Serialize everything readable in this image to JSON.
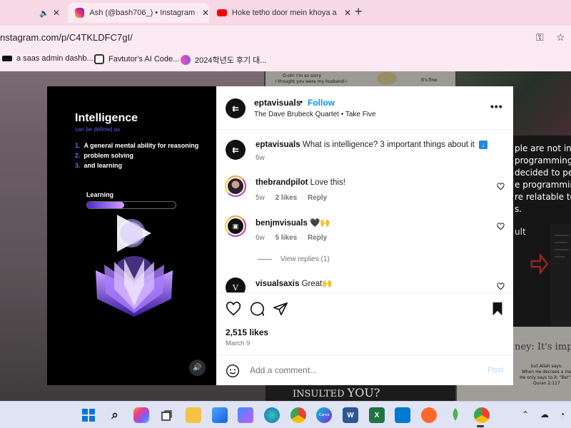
{
  "browser": {
    "tabs": [
      {
        "title": "Ash (@bash706_) • Instagram p",
        "icon": "instagram-icon"
      },
      {
        "title": "Hoke tetho door mein khoya a",
        "icon": "youtube-icon"
      }
    ],
    "tab_close": "✕",
    "new_tab": "+",
    "url": "nstagram.com/p/C4TKLDFC7gI/",
    "bookmarks": [
      {
        "label": "a saas admin dashb..."
      },
      {
        "label": "Favtutor's AI Code..."
      },
      {
        "label": "2024학년도 후기 대..."
      }
    ]
  },
  "backdrop": {
    "left_caption": "O-oh! I'm so sorry\nI thought you were my husband-!",
    "right_caption": "It's fine",
    "right_text": [
      "ple are not inte",
      "programming, so",
      "decided to pers",
      "e programming",
      "re relatable to",
      "s."
    ],
    "ult_label": "ult",
    "bottom_right": "ney: It's impo",
    "insulted": "INSULTED",
    "you": "YOU?",
    "allah_text": [
      "but Allah says:",
      "When He decrees a ma",
      "He only says to it: \"Be!\" -",
      "Quran 2:117"
    ]
  },
  "post": {
    "media": {
      "title": "Intelligence",
      "subtitle": "can be defined as",
      "list": [
        {
          "num": "1.",
          "text": "A general mental ability for reasoning"
        },
        {
          "num": "2.",
          "text": "problem solving"
        },
        {
          "num": "3.",
          "text": "and learning"
        }
      ],
      "learning_label": "Learning",
      "learning_progress": 0.42
    },
    "header": {
      "username": "eptavisuals",
      "separator": "•",
      "follow": "Follow",
      "audio": "The Dave Brubeck Quartet • Take Five",
      "more": "•••"
    },
    "caption": {
      "username": "eptavisuals",
      "text": "What is intelligence? 3 important things about it",
      "time": "6w"
    },
    "comments": [
      {
        "username": "thebrandpilot",
        "text": "Love this!",
        "time": "5w",
        "likes": "2 likes",
        "reply": "Reply"
      },
      {
        "username": "benjmvisuals",
        "text": "🖤🙌",
        "time": "6w",
        "likes": "5 likes",
        "reply": "Reply",
        "view_replies": "View replies (1)"
      },
      {
        "username": "visualsaxis",
        "text": "Great🙌"
      }
    ],
    "likes": "2,515 likes",
    "date": "March 9",
    "add_comment_placeholder": "Add a comment...",
    "post_label": "Post"
  },
  "colors": {
    "accent": "#0095f6",
    "tab_bg": "#f7d9e5",
    "taskbar_bg": "#dfe3f3"
  },
  "taskbar": {
    "icons": [
      "windows-icon",
      "search-icon",
      "copilot-icon",
      "task-view-icon",
      "file-explorer-icon",
      "photos-icon",
      "store-icon",
      "edge-icon",
      "chrome-icon",
      "canva-icon",
      "word-icon",
      "excel-icon",
      "vscode-icon",
      "pen-icon",
      "mongodb-icon",
      "chrome-profile-icon"
    ],
    "tray": [
      "chevron-up-icon",
      "cloud-icon",
      "wifi-icon"
    ],
    "labels": {
      "canva": "Canva",
      "word": "W",
      "excel": "X"
    }
  }
}
